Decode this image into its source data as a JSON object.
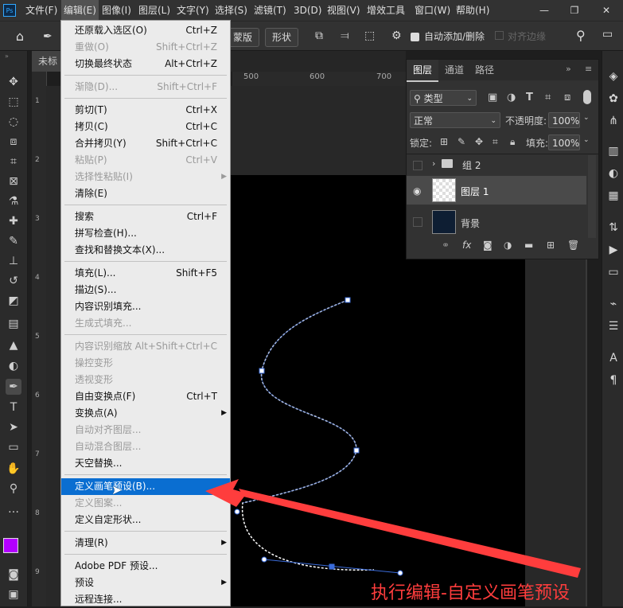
{
  "menubar": {
    "logo": "Ps",
    "items": [
      "文件(F)",
      "编辑(E)",
      "图像(I)",
      "图层(L)",
      "文字(Y)",
      "选择(S)",
      "滤镜(T)",
      "3D(D)",
      "视图(V)",
      "增效工具",
      "窗口(W)",
      "帮助(H)"
    ]
  },
  "options": {
    "mode_label": "蒙版",
    "shape_label": "形状",
    "auto_add_label": "自动添加/删除",
    "align_edges_label": "对齐边缘"
  },
  "document": {
    "tab_label": "未标",
    "ruler_marks": [
      "500",
      "600",
      "700"
    ],
    "left_ruler_marks": [
      "1",
      "2",
      "3",
      "4",
      "5",
      "6",
      "7",
      "8",
      "9"
    ]
  },
  "layers_panel": {
    "tabs": [
      "图层",
      "通道",
      "路径"
    ],
    "filter_label": "类型",
    "blend_mode": "正常",
    "opacity_label": "不透明度:",
    "opacity_value": "100%",
    "lock_label": "锁定:",
    "fill_label": "填充:",
    "fill_value": "100%",
    "layers": [
      {
        "name": "组 2"
      },
      {
        "name": "图层 1"
      },
      {
        "name": "背景"
      }
    ]
  },
  "edit_menu": {
    "items": [
      {
        "label": "还原载入选区(O)",
        "shortcut": "Ctrl+Z",
        "enabled": true
      },
      {
        "label": "重做(O)",
        "shortcut": "Shift+Ctrl+Z",
        "enabled": false
      },
      {
        "label": "切换最终状态",
        "shortcut": "Alt+Ctrl+Z",
        "enabled": true
      },
      {
        "label": "渐隐(D)...",
        "shortcut": "Shift+Ctrl+F",
        "enabled": false
      },
      {
        "label": "剪切(T)",
        "shortcut": "Ctrl+X",
        "enabled": true
      },
      {
        "label": "拷贝(C)",
        "shortcut": "Ctrl+C",
        "enabled": true
      },
      {
        "label": "合并拷贝(Y)",
        "shortcut": "Shift+Ctrl+C",
        "enabled": true
      },
      {
        "label": "粘贴(P)",
        "shortcut": "Ctrl+V",
        "enabled": false
      },
      {
        "label": "选择性粘贴(I)",
        "shortcut": "",
        "enabled": false,
        "submenu": true
      },
      {
        "label": "清除(E)",
        "shortcut": "",
        "enabled": true
      },
      {
        "label": "搜索",
        "shortcut": "Ctrl+F",
        "enabled": true
      },
      {
        "label": "拼写检查(H)...",
        "shortcut": "",
        "enabled": true
      },
      {
        "label": "查找和替换文本(X)...",
        "shortcut": "",
        "enabled": true
      },
      {
        "label": "填充(L)...",
        "shortcut": "Shift+F5",
        "enabled": true
      },
      {
        "label": "描边(S)...",
        "shortcut": "",
        "enabled": true
      },
      {
        "label": "内容识别填充...",
        "shortcut": "",
        "enabled": true
      },
      {
        "label": "生成式填充...",
        "shortcut": "",
        "enabled": false
      },
      {
        "label": "内容识别缩放",
        "shortcut": "Alt+Shift+Ctrl+C",
        "enabled": false
      },
      {
        "label": "操控变形",
        "shortcut": "",
        "enabled": false
      },
      {
        "label": "透视变形",
        "shortcut": "",
        "enabled": false
      },
      {
        "label": "自由变换点(F)",
        "shortcut": "Ctrl+T",
        "enabled": true
      },
      {
        "label": "变换点(A)",
        "shortcut": "",
        "enabled": true,
        "submenu": true
      },
      {
        "label": "自动对齐图层...",
        "shortcut": "",
        "enabled": false
      },
      {
        "label": "自动混合图层...",
        "shortcut": "",
        "enabled": false
      },
      {
        "label": "天空替换...",
        "shortcut": "",
        "enabled": true
      },
      {
        "label": "定义画笔预设(B)...",
        "shortcut": "",
        "enabled": true,
        "highlighted": true
      },
      {
        "label": "定义图案...",
        "shortcut": "",
        "enabled": false
      },
      {
        "label": "定义自定形状...",
        "shortcut": "",
        "enabled": true
      },
      {
        "label": "清理(R)",
        "shortcut": "",
        "enabled": true,
        "submenu": true
      },
      {
        "label": "Adobe PDF 预设...",
        "shortcut": "",
        "enabled": true
      },
      {
        "label": "预设",
        "shortcut": "",
        "enabled": true,
        "submenu": true
      },
      {
        "label": "远程连接...",
        "shortcut": "",
        "enabled": true
      }
    ]
  },
  "annotation": "执行编辑-自定义画笔预设",
  "colors": {
    "accent": "#0a6ed1",
    "annotation": "#ff3d3d",
    "foreground_swatch": "#b300ff",
    "background_swatch": "#000000"
  }
}
